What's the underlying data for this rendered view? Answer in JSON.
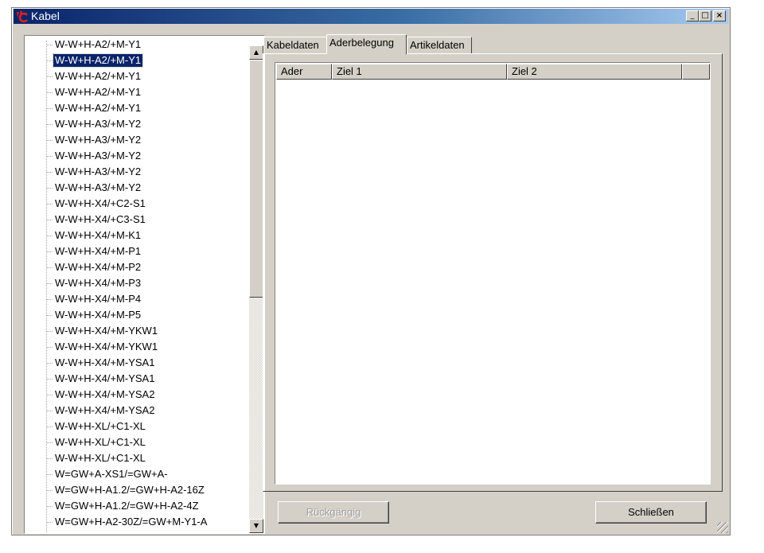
{
  "window": {
    "title": "Kabel",
    "controls": {
      "minimize": "_",
      "maximize": "□",
      "close": "×"
    }
  },
  "colors": {
    "title_start": "#0a246a",
    "title_end": "#a6caf0",
    "selection": "#0a246a",
    "face": "#d4d0c8",
    "logo_red": "#e02020"
  },
  "tree": {
    "selected_index": 1,
    "items": [
      "W-W+H-A2/+M-Y1",
      "W-W+H-A2/+M-Y1",
      "W-W+H-A2/+M-Y1",
      "W-W+H-A2/+M-Y1",
      "W-W+H-A2/+M-Y1",
      "W-W+H-A3/+M-Y2",
      "W-W+H-A3/+M-Y2",
      "W-W+H-A3/+M-Y2",
      "W-W+H-A3/+M-Y2",
      "W-W+H-A3/+M-Y2",
      "W-W+H-X4/+C2-S1",
      "W-W+H-X4/+C3-S1",
      "W-W+H-X4/+M-K1",
      "W-W+H-X4/+M-P1",
      "W-W+H-X4/+M-P2",
      "W-W+H-X4/+M-P3",
      "W-W+H-X4/+M-P4",
      "W-W+H-X4/+M-P5",
      "W-W+H-X4/+M-YKW1",
      "W-W+H-X4/+M-YKW1",
      "W-W+H-X4/+M-YSA1",
      "W-W+H-X4/+M-YSA1",
      "W-W+H-X4/+M-YSA2",
      "W-W+H-X4/+M-YSA2",
      "W-W+H-XL/+C1-XL",
      "W-W+H-XL/+C1-XL",
      "W-W+H-XL/+C1-XL",
      "W=GW+A-XS1/=GW+A-",
      "W=GW+H-A1.2/=GW+H-A2-16Z",
      "W=GW+H-A1.2/=GW+H-A2-4Z",
      "W=GW+H-A2-30Z/=GW+M-Y1-A"
    ]
  },
  "tabs": {
    "active": "Aderbelegung",
    "items": [
      "Kabeldaten",
      "Aderbelegung",
      "Artikeldaten"
    ]
  },
  "table": {
    "columns": [
      "Ader",
      "Ziel 1",
      "Ziel 2"
    ],
    "rows": []
  },
  "buttons": {
    "undo": "Rückgängig",
    "close": "Schließen"
  }
}
